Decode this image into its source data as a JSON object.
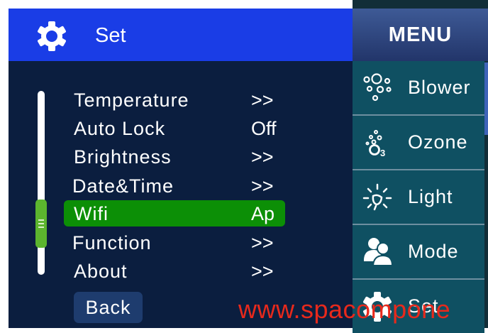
{
  "header": {
    "title": "Set",
    "icon": "gear-icon"
  },
  "settings": {
    "items": [
      {
        "label": "Temperature",
        "value": ">>"
      },
      {
        "label": "Auto Lock",
        "value": "Off"
      },
      {
        "label": "Brightness",
        "value": ">>"
      },
      {
        "label": "Date&Time",
        "value": ">>"
      },
      {
        "label": "Wifi",
        "value": "Ap",
        "selected": true
      },
      {
        "label": "Function",
        "value": ">>"
      },
      {
        "label": "About",
        "value": ">>"
      }
    ],
    "back_label": "Back"
  },
  "menu": {
    "title": "MENU",
    "items": [
      {
        "label": "Blower",
        "icon": "bubbles-icon"
      },
      {
        "label": "Ozone",
        "icon": "ozone-icon"
      },
      {
        "label": "Light",
        "icon": "bulb-icon"
      },
      {
        "label": "Mode",
        "icon": "people-icon"
      },
      {
        "label": "Set",
        "icon": "gear-icon"
      }
    ]
  },
  "watermark": "www.spacompone",
  "colors": {
    "header_blue": "#1a3de6",
    "panel_navy": "#0b1e3f",
    "selected_green": "#0c8f06",
    "menu_teal": "#0f5062",
    "watermark_red": "#e8291c"
  }
}
